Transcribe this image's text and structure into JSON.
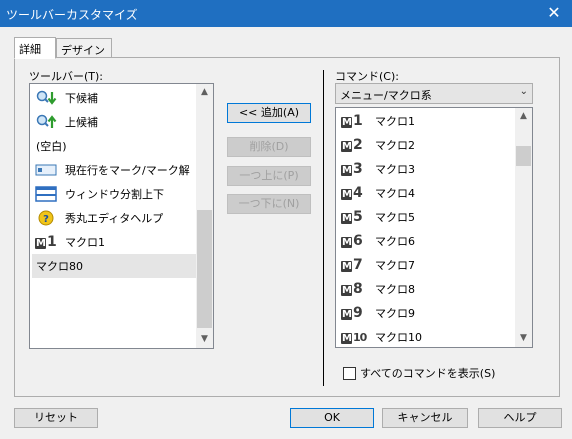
{
  "window": {
    "title": "ツールバーカスタマイズ"
  },
  "tabs": [
    {
      "label": "詳細"
    },
    {
      "label": "デザイン"
    }
  ],
  "toolbar_list": {
    "label": "ツールバー(T):",
    "items": [
      {
        "label": "下候補",
        "icon": "search-down-icon"
      },
      {
        "label": "上候補",
        "icon": "search-up-icon"
      },
      {
        "label": "(空白)",
        "icon": ""
      },
      {
        "label": "現在行をマーク/マーク解",
        "icon": "mark-line-icon"
      },
      {
        "label": "ウィンドウ分割上下",
        "icon": "split-window-icon"
      },
      {
        "label": "秀丸エディタヘルプ",
        "icon": "help-icon"
      },
      {
        "label": "マクロ1",
        "icon": "macro-1-icon",
        "num": "1"
      },
      {
        "label": "マクロ80",
        "icon": "",
        "selected": true
      }
    ]
  },
  "middle_buttons": {
    "add": "<< 追加(A)",
    "delete": "削除(D)",
    "up": "一つ上に(P)",
    "down": "一つ下に(N)"
  },
  "command_list": {
    "label": "コマンド(C):",
    "category": "メニュー/マクロ系",
    "items": [
      {
        "label": "マクロ1",
        "num": "1"
      },
      {
        "label": "マクロ2",
        "num": "2"
      },
      {
        "label": "マクロ3",
        "num": "3"
      },
      {
        "label": "マクロ4",
        "num": "4"
      },
      {
        "label": "マクロ5",
        "num": "5"
      },
      {
        "label": "マクロ6",
        "num": "6"
      },
      {
        "label": "マクロ7",
        "num": "7"
      },
      {
        "label": "マクロ8",
        "num": "8"
      },
      {
        "label": "マクロ9",
        "num": "9"
      },
      {
        "label": "マクロ10",
        "num": "10"
      }
    ]
  },
  "show_all": {
    "label": "すべてのコマンドを表示(S)",
    "checked": false
  },
  "footer": {
    "reset": "リセット",
    "ok": "OK",
    "cancel": "キャンセル",
    "help": "ヘルプ"
  }
}
